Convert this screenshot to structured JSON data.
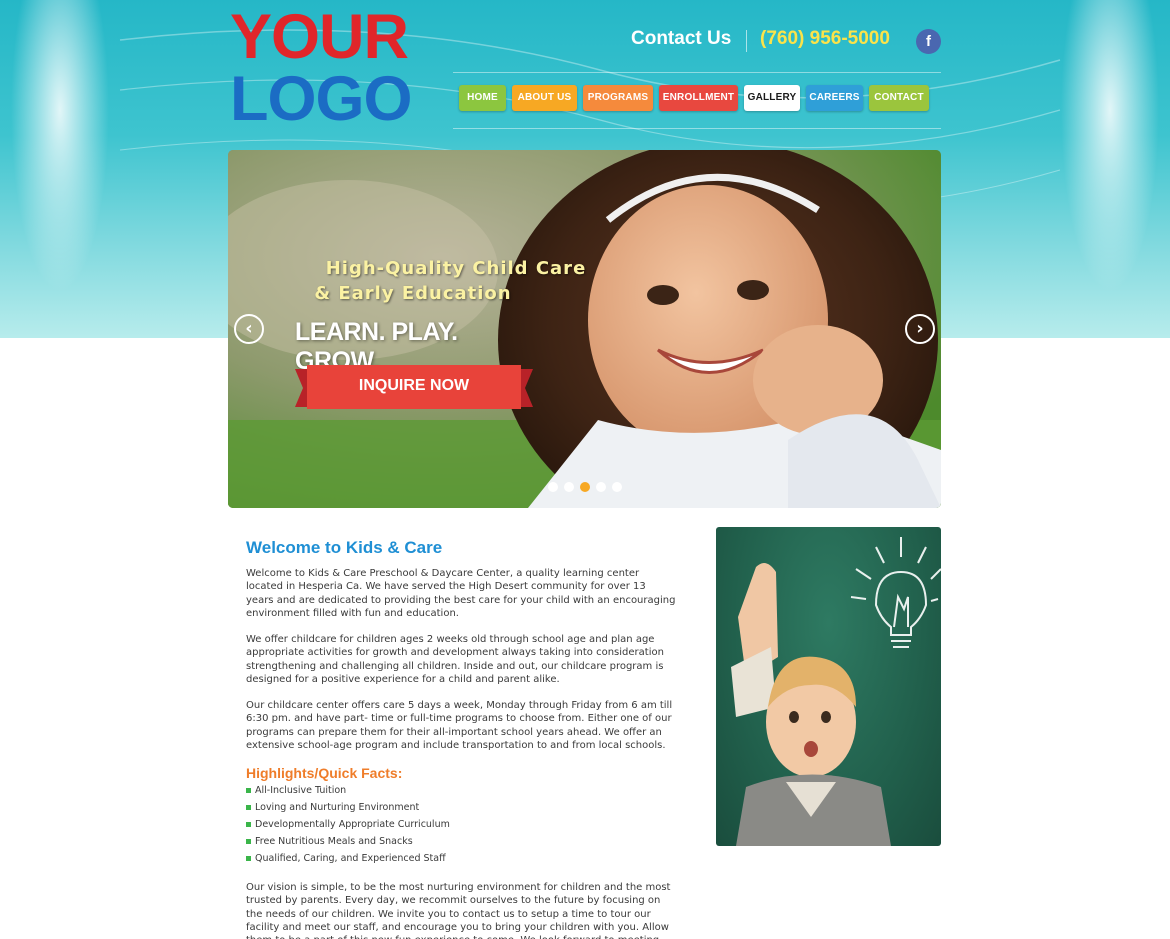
{
  "header": {
    "logo_line1": "YOUR",
    "logo_line2": "LOGO",
    "contact_label": "Contact Us",
    "phone": "(760) 956-5000",
    "facebook_glyph": "f"
  },
  "nav": {
    "items": [
      {
        "label": "HOME",
        "color": "#8cc63f"
      },
      {
        "label": "ABOUT US",
        "color": "#f7a823"
      },
      {
        "label": "PROGRAMS",
        "color": "#f58a3c"
      },
      {
        "label": "ENROLLMENT",
        "color": "#e8483f"
      },
      {
        "label": "GALLERY",
        "color": "#ffffff"
      },
      {
        "label": "CAREERS",
        "color": "#2f9fd8"
      },
      {
        "label": "CONTACT",
        "color": "#9bc53d"
      }
    ]
  },
  "slider": {
    "tagline_line1": "High-Quality Child Care",
    "tagline_line2": "& Early Education",
    "motto": "LEARN. PLAY. GROW.",
    "cta": "INQUIRE NOW",
    "prev_glyph": "‹",
    "next_glyph": "›",
    "slide_count": 5,
    "active_slide": 3
  },
  "content": {
    "heading": "Welcome to Kids & Care",
    "paragraphs": [
      "Welcome to Kids & Care Preschool & Daycare Center, a quality learning center located in Hesperia Ca. We have served the High Desert community for over 13 years and are dedicated to providing the best care for your child with an encouraging environment filled with fun and education.",
      "We offer childcare for children ages 2 weeks old through school age and plan age appropriate activities for growth and development always taking into consideration strengthening and challenging all children. Inside and out, our childcare program is designed for a positive experience for a child and parent alike.",
      "Our childcare center offers care 5 days a week, Monday through Friday from 6 am till 6:30 pm. and have part- time or full-time programs to choose from. Either one of our programs can prepare them for their all-important school years ahead. We offer an extensive school-age program and include transportation to and from local schools.",
      "Our vision is simple, to be the most nurturing environment for children and the most trusted by parents. Every day, we recommit ourselves to the future by focusing on the needs of our children. We invite you to contact us to setup a time to tour our facility and meet our staff, and encourage you to bring your children with you. Allow them to be a part of this new fun experience to come. We look forward to meeting you and your children."
    ],
    "highlights_heading": "Highlights/Quick Facts:",
    "highlights": [
      "All-Inclusive Tuition",
      "Loving and Nurturing Environment",
      "Developmentally Appropriate Curriculum",
      "Free Nutritious Meals and Snacks",
      "Qualified, Caring, and Experienced Staff"
    ]
  },
  "colors": {
    "brand_red": "#e0262a",
    "brand_blue": "#1b6cc4",
    "heading_blue": "#1f8fd4",
    "heading_orange": "#ef7d2a",
    "phone_yellow": "#fbe349",
    "bullet_green": "#3ab54a"
  }
}
